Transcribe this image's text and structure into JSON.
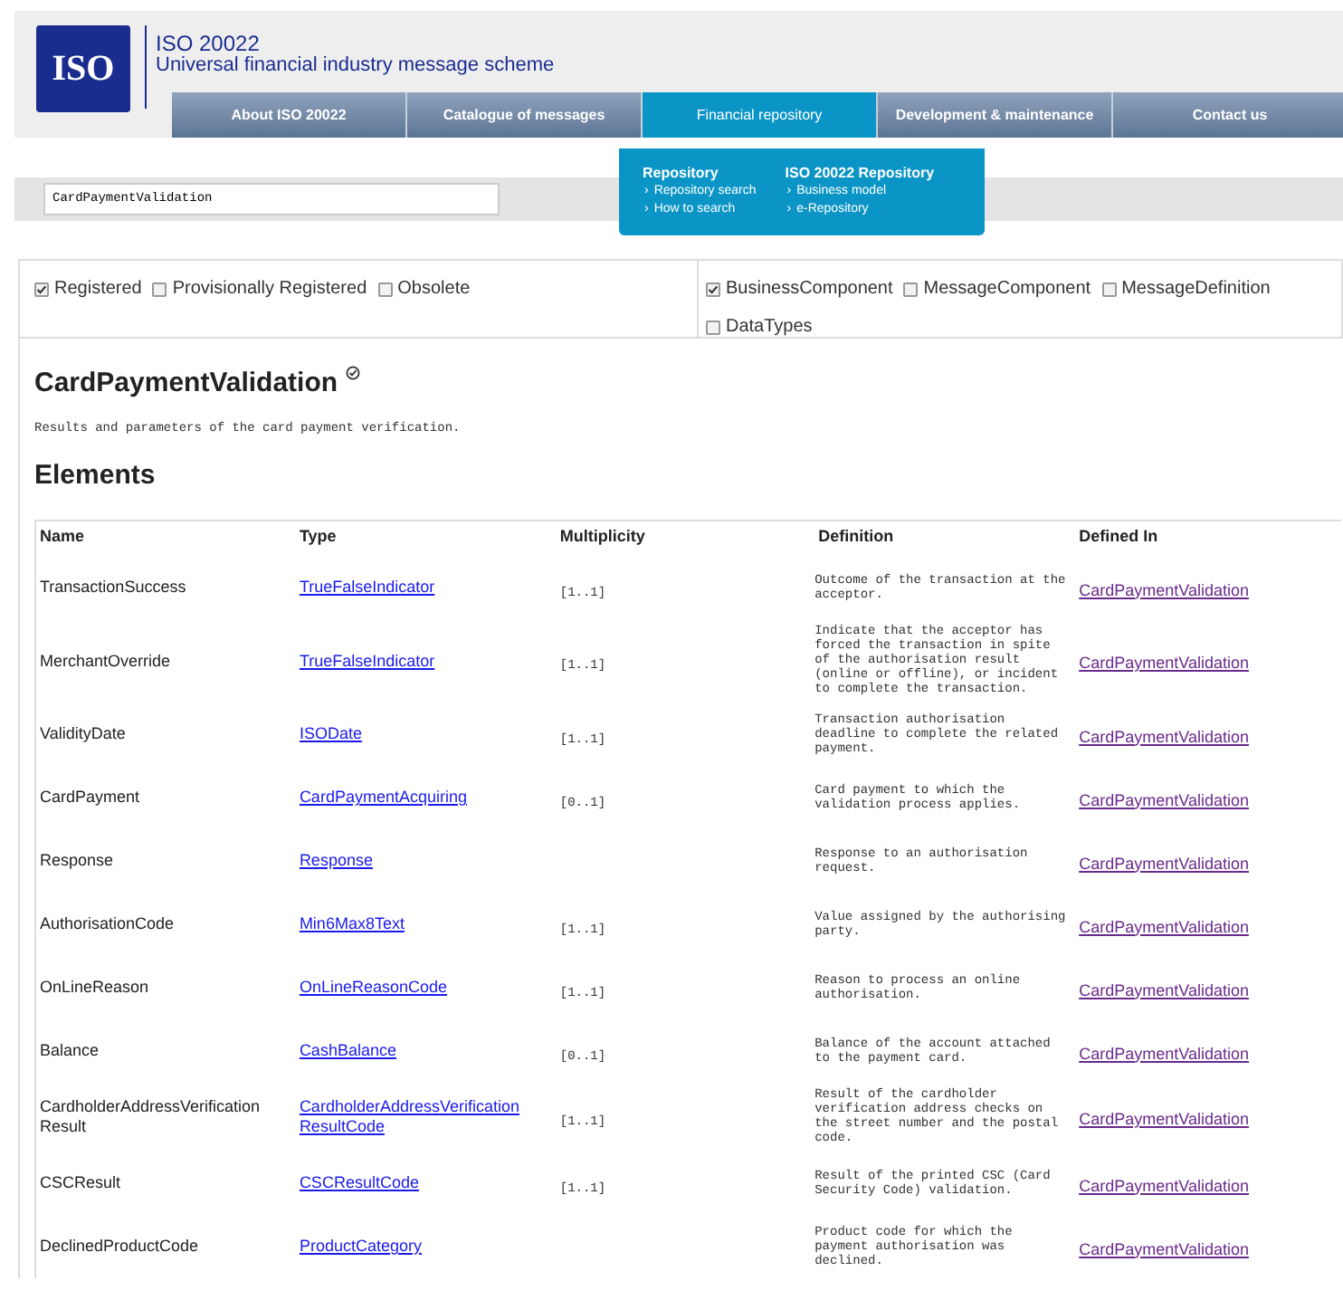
{
  "header": {
    "logo": "ISO",
    "title": "ISO 20022",
    "subtitle": "Universal financial industry message scheme"
  },
  "nav": [
    {
      "label": "About ISO 20022",
      "selected": false
    },
    {
      "label": "Catalogue of messages",
      "selected": false
    },
    {
      "label": "Financial repository",
      "selected": true
    },
    {
      "label": "Development & maintenance",
      "selected": false
    },
    {
      "label": "Contact us",
      "selected": false
    }
  ],
  "dropdown": [
    {
      "heading": "Repository",
      "links": [
        "Repository search",
        "How to search"
      ]
    },
    {
      "heading": "ISO 20022 Repository",
      "links": [
        "Business model",
        "e-Repository"
      ]
    }
  ],
  "dropdown_bullet": "›",
  "search": {
    "value": "CardPaymentValidation"
  },
  "status_filters": [
    {
      "label": "Registered",
      "checked": true
    },
    {
      "label": "Provisionally Registered",
      "checked": false
    },
    {
      "label": "Obsolete",
      "checked": false
    }
  ],
  "type_filters": [
    {
      "label": "BusinessComponent",
      "checked": true
    },
    {
      "label": "MessageComponent",
      "checked": false
    },
    {
      "label": "MessageDefinition",
      "checked": false
    },
    {
      "label": "DataTypes",
      "checked": false
    }
  ],
  "title": "CardPaymentValidation",
  "description": "Results and parameters of the card payment verification.",
  "section_heading": "Elements",
  "table": {
    "columns": [
      "Name",
      "Type",
      "Multiplicity",
      "Definition",
      "Defined In"
    ],
    "rows": [
      {
        "name": "TransactionSuccess",
        "type": "TrueFalseIndicator",
        "multiplicity": "[1..1]",
        "definition": "Outcome of the transaction at the acceptor.",
        "defined_in": "CardPaymentValidation"
      },
      {
        "name": "MerchantOverride",
        "type": "TrueFalseIndicator",
        "multiplicity": "[1..1]",
        "definition": "Indicate that the acceptor has forced the transaction in spite of the authorisation result (online or offline), or incident to complete the transaction.",
        "defined_in": "CardPaymentValidation"
      },
      {
        "name": "ValidityDate",
        "type": "ISODate",
        "multiplicity": "[1..1]",
        "definition": "Transaction authorisation deadline to complete the related payment.",
        "defined_in": "CardPaymentValidation"
      },
      {
        "name": "CardPayment",
        "type": "CardPaymentAcquiring",
        "multiplicity": "[0..1]",
        "definition": "Card payment to which the validation process applies.",
        "defined_in": "CardPaymentValidation"
      },
      {
        "name": "Response",
        "type": "Response",
        "definition": "Response to an authorisation request.",
        "defined_in": "CardPaymentValidation"
      },
      {
        "name": "AuthorisationCode",
        "type": "Min6Max8Text",
        "multiplicity": "[1..1]",
        "definition": "Value assigned by the authorising party.",
        "defined_in": "CardPaymentValidation"
      },
      {
        "name": "OnLineReason",
        "type": "OnLineReasonCode",
        "multiplicity": "[1..1]",
        "definition": "Reason to process an online authorisation.",
        "defined_in": "CardPaymentValidation"
      },
      {
        "name": "Balance",
        "type": "CashBalance",
        "multiplicity": "[0..1]",
        "definition": "Balance of the account attached to the payment card.",
        "defined_in": "CardPaymentValidation"
      },
      {
        "name": "CardholderAddressVerification Result",
        "type": "CardholderAddressVerification ResultCode",
        "multiplicity": "[1..1]",
        "definition": "Result of the cardholder verification address checks on the street number and the postal code.",
        "defined_in": "CardPaymentValidation"
      },
      {
        "name": "CSCResult",
        "type": "CSCResultCode",
        "multiplicity": "[1..1]",
        "definition": "Result of the printed CSC (Card Security Code) validation.",
        "defined_in": "CardPaymentValidation"
      },
      {
        "name": "DeclinedProductCode",
        "type": "ProductCategory",
        "definition": "Product code for which the payment authorisation was declined.",
        "defined_in": "CardPaymentValidation"
      }
    ]
  }
}
